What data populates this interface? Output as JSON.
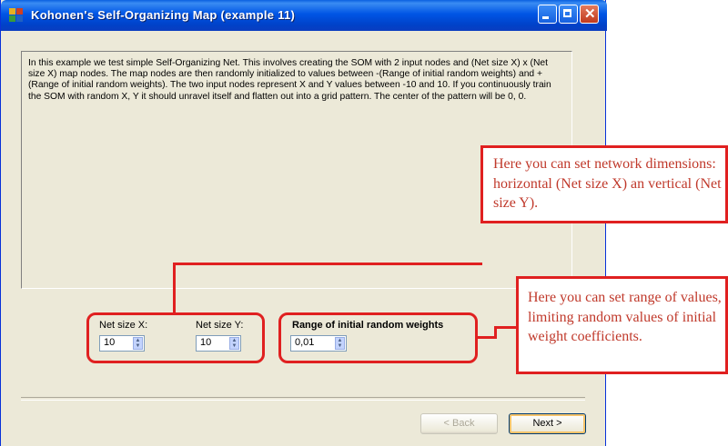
{
  "window": {
    "title": "Kohonen's Self-Organizing Map (example 11)"
  },
  "description": "In this example we test simple Self-Organizing Net. This involves creating the SOM with 2 input nodes and (Net size X) x (Net size X) map nodes. The map nodes are then randomly initialized to values between -(Range of initial random weights) and +(Range of initial random weights). The two input nodes represent X and  Y values between -10 and 10. If you continuously train the SOM with random X, Y it should unravel itself and flatten out into a grid pattern. The center of the pattern will be 0, 0.",
  "fields": {
    "net_size_x": {
      "label": "Net size X:",
      "value": "10"
    },
    "net_size_y": {
      "label": "Net size Y:",
      "value": "10"
    },
    "range": {
      "label": "Range of initial random weights",
      "value": "0,01"
    }
  },
  "buttons": {
    "back": "< Back",
    "next": "Next >"
  },
  "callouts": {
    "net_size": "Here you can set network dimensions: horizontal (Net size X) an vertical (Net size Y).",
    "range": "Here you can set range of values, limiting random values of initial weight coefficients."
  },
  "colors": {
    "titlebar": "#0055e5",
    "highlight": "#e02020",
    "callout_text": "#c0392b",
    "window_bg": "#ece9d8"
  },
  "icons": {
    "spin_up": "▲",
    "spin_down": "▼",
    "close": "✕"
  }
}
